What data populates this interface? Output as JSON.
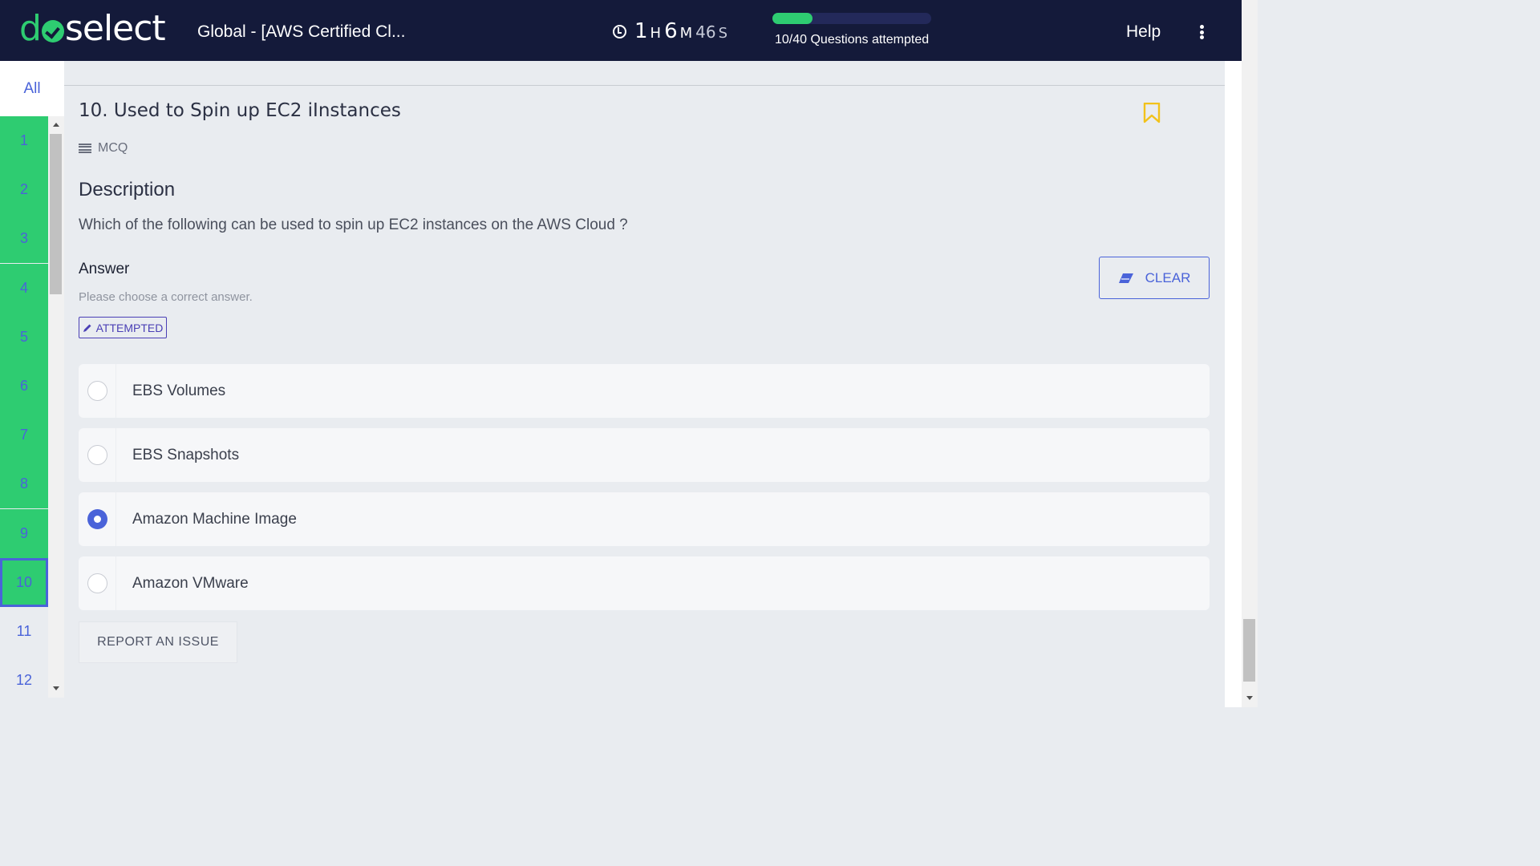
{
  "header": {
    "logo_text": "doselect",
    "test_title": "Global - [AWS Certified Cl...",
    "timer": {
      "hours": "1",
      "hours_unit": "H",
      "minutes": "6",
      "minutes_unit": "M",
      "seconds": "46",
      "seconds_unit": "S"
    },
    "progress": {
      "attempted": 10,
      "total": 40,
      "fraction": 0.25,
      "label": "10/40 Questions attempted"
    },
    "help_label": "Help",
    "colors": {
      "background": "#141a3a",
      "accent": "#2ecc71"
    }
  },
  "nav": {
    "all_label": "All",
    "items": [
      {
        "label": "1",
        "status": "attempted"
      },
      {
        "label": "2",
        "status": "attempted"
      },
      {
        "label": "3",
        "status": "attempted"
      },
      {
        "label": "4",
        "status": "attempted"
      },
      {
        "label": "5",
        "status": "attempted"
      },
      {
        "label": "6",
        "status": "attempted"
      },
      {
        "label": "7",
        "status": "attempted"
      },
      {
        "label": "8",
        "status": "attempted"
      },
      {
        "label": "9",
        "status": "attempted"
      },
      {
        "label": "10",
        "status": "current"
      },
      {
        "label": "11",
        "status": "not-attempted"
      },
      {
        "label": "12",
        "status": "not-attempted"
      }
    ]
  },
  "question": {
    "title": "10. Used to Spin up EC2 iInstances",
    "type_label": "MCQ",
    "description_heading": "Description",
    "description_text": "Which of the following can be used to spin up EC2 instances on the AWS Cloud ?",
    "answer_heading": "Answer",
    "answer_hint": "Please choose a correct answer.",
    "status_badge": "ATTEMPTED",
    "clear_label": "CLEAR",
    "options": [
      {
        "label": "EBS Volumes",
        "selected": false
      },
      {
        "label": "EBS Snapshots",
        "selected": false
      },
      {
        "label": "Amazon Machine Image",
        "selected": true
      },
      {
        "label": "Amazon VMware",
        "selected": false
      }
    ],
    "report_label": "REPORT AN ISSUE"
  },
  "icons": {
    "timer": "clock-icon",
    "bookmark": "bookmark-icon",
    "type": "list-icon",
    "badge": "pencil-icon",
    "clear": "eraser-icon",
    "menu": "kebab-menu-icon"
  }
}
